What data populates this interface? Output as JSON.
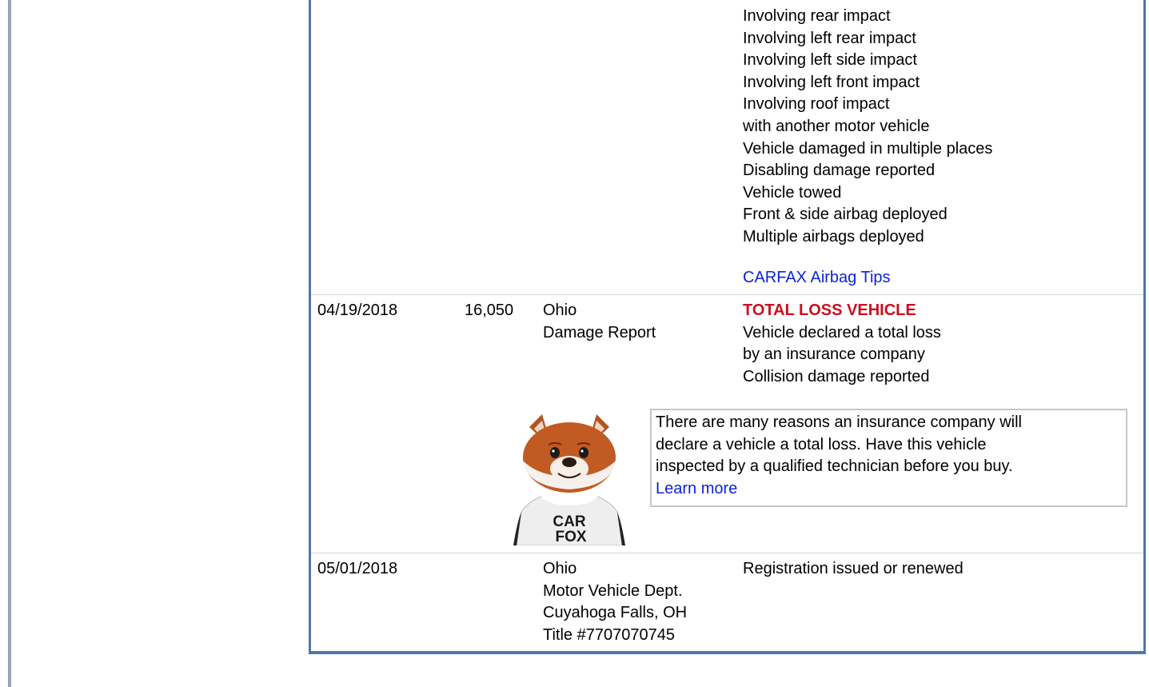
{
  "records": [
    {
      "date": "",
      "mileage": "",
      "source": [],
      "details": [
        "Involving rear impact",
        "Involving left rear impact",
        "Involving left side impact",
        "Involving left front impact",
        "Involving roof impact",
        "with another motor vehicle",
        "Vehicle damaged in multiple places",
        "Disabling damage reported",
        "Vehicle towed",
        "Front & side airbag deployed",
        "Multiple airbags deployed"
      ],
      "link": "CARFAX Airbag Tips"
    },
    {
      "date": "04/19/2018",
      "mileage": "16,050",
      "source": [
        "Ohio",
        "Damage Report"
      ],
      "alert": "TOTAL LOSS VEHICLE",
      "details": [
        "Vehicle declared a total loss",
        "by an insurance company",
        "Collision damage reported"
      ],
      "callout": {
        "lines": [
          "There are many reasons an insurance company will",
          "declare a vehicle a total loss. Have this vehicle",
          "inspected by a qualified technician before you buy."
        ],
        "link": "Learn more"
      },
      "mascot_text": [
        "CAR",
        "FOX"
      ]
    },
    {
      "date": "05/01/2018",
      "mileage": "",
      "source": [
        "Ohio",
        "Motor Vehicle Dept.",
        "Cuyahoga Falls, OH",
        "Title #7707070745"
      ],
      "details": [
        "Registration issued or renewed"
      ]
    }
  ],
  "colors": {
    "accent_border": "#4f77a8",
    "alert_red": "#c8101f",
    "link_blue": "#0b24d6"
  },
  "icons": {
    "mascot": "carfox-mascot-icon"
  }
}
